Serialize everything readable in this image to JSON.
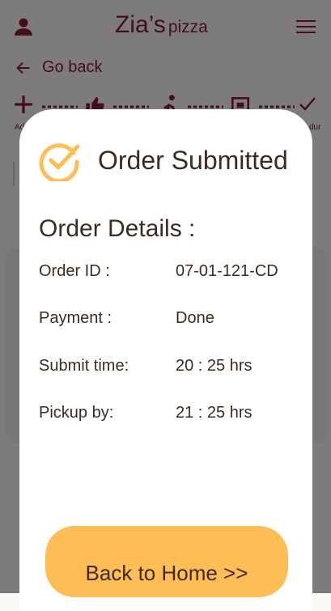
{
  "header": {
    "brand_name": "Zia’s",
    "brand_sub": "pizza"
  },
  "nav": {
    "go_back": "Go back"
  },
  "steps": [
    {
      "label": "Ad"
    },
    {
      "label": ""
    },
    {
      "label": ""
    },
    {
      "label": ""
    },
    {
      "label": "dur"
    }
  ],
  "modal": {
    "title": "Order Submitted",
    "details_heading": "Order Details :",
    "rows": [
      {
        "label": "Order ID :",
        "value": "07-01-121-CD"
      },
      {
        "label": "Payment :",
        "value": "Done"
      },
      {
        "label": "Submit time:",
        "value": "20 : 25 hrs"
      },
      {
        "label": "Pickup by:",
        "value": "21 : 25 hrs"
      }
    ],
    "home_button": "Back to Home >>"
  },
  "colors": {
    "brand": "#8b1c3b",
    "accent": "#ffbe55",
    "text": "#3d2b1f"
  }
}
